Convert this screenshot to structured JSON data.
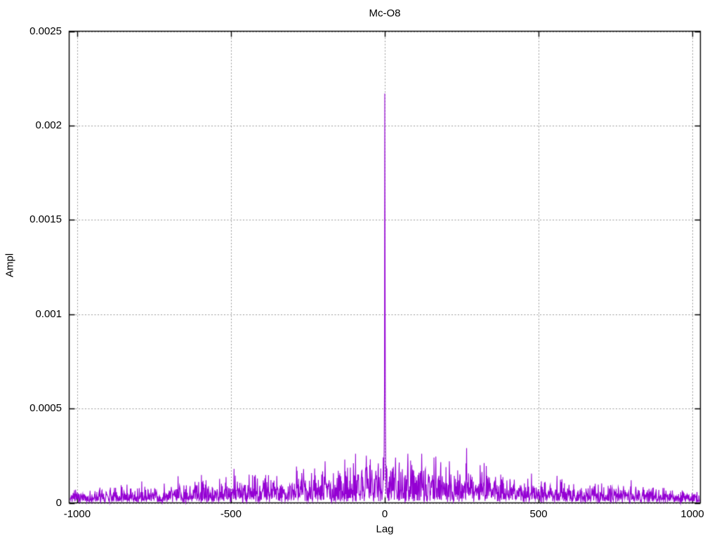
{
  "window": {
    "background": "#ffffff"
  },
  "chart_data": {
    "type": "line",
    "title": "Mc-O8",
    "xlabel": "Lag",
    "ylabel": "Ampl",
    "xlim": [
      -1026,
      1026
    ],
    "ylim": [
      0,
      0.0025
    ],
    "xticks": {
      "values": [
        -1000,
        -500,
        0,
        500,
        1000
      ],
      "labels": [
        "-1000",
        "-500",
        "0",
        "500",
        "1000"
      ]
    },
    "yticks": {
      "values": [
        0,
        0.0005,
        0.001,
        0.0015,
        0.002,
        0.0025
      ],
      "labels": [
        "0",
        "0.0005",
        "0.001",
        "0.0015",
        "0.002",
        "0.0025"
      ]
    },
    "grid": true,
    "legend": "none",
    "line_color": "#9400d3",
    "grid_color": "#9a9a9a",
    "border_color": "#000000",
    "peak": {
      "lag": 0,
      "value": 0.00217
    },
    "peak_cluster": [
      [
        -2,
        0.0003
      ],
      [
        -1,
        0.0006
      ],
      [
        0,
        0.00217
      ],
      [
        1,
        0.0013
      ],
      [
        2,
        0.00045
      ]
    ],
    "notable_spikes": [
      [
        -490,
        0.00018
      ],
      [
        -285,
        0.00017
      ],
      [
        -194,
        0.00022
      ],
      [
        -130,
        0.00023
      ],
      [
        -95,
        0.00026
      ],
      [
        -60,
        0.00025
      ],
      [
        35,
        0.00024
      ],
      [
        75,
        0.00026
      ],
      [
        120,
        0.00026
      ],
      [
        160,
        0.00024
      ],
      [
        210,
        0.00022
      ],
      [
        266,
        0.00029
      ],
      [
        310,
        0.0002
      ],
      [
        801,
        0.00012
      ]
    ],
    "noise_envelope": [
      [
        -1024,
        5e-05
      ],
      [
        -950,
        6e-05
      ],
      [
        -850,
        8e-05
      ],
      [
        -750,
        9e-05
      ],
      [
        -650,
        0.0001
      ],
      [
        -550,
        0.00012
      ],
      [
        -450,
        0.00013
      ],
      [
        -350,
        0.00014
      ],
      [
        -250,
        0.00016
      ],
      [
        -150,
        0.0002
      ],
      [
        -80,
        0.00023
      ],
      [
        -30,
        0.00024
      ],
      [
        0,
        0.00024
      ],
      [
        30,
        0.00023
      ],
      [
        80,
        0.00023
      ],
      [
        150,
        0.00021
      ],
      [
        250,
        0.00018
      ],
      [
        350,
        0.00015
      ],
      [
        450,
        0.00013
      ],
      [
        550,
        0.00012
      ],
      [
        650,
        0.0001
      ],
      [
        750,
        9e-05
      ],
      [
        850,
        8e-05
      ],
      [
        950,
        6e-05
      ],
      [
        1024,
        5e-05
      ]
    ],
    "noise": {
      "seed": 7,
      "sigma_divisor": 2.2,
      "floor": 1.2e-05,
      "lag_min": -1023,
      "lag_max": 1024
    }
  }
}
